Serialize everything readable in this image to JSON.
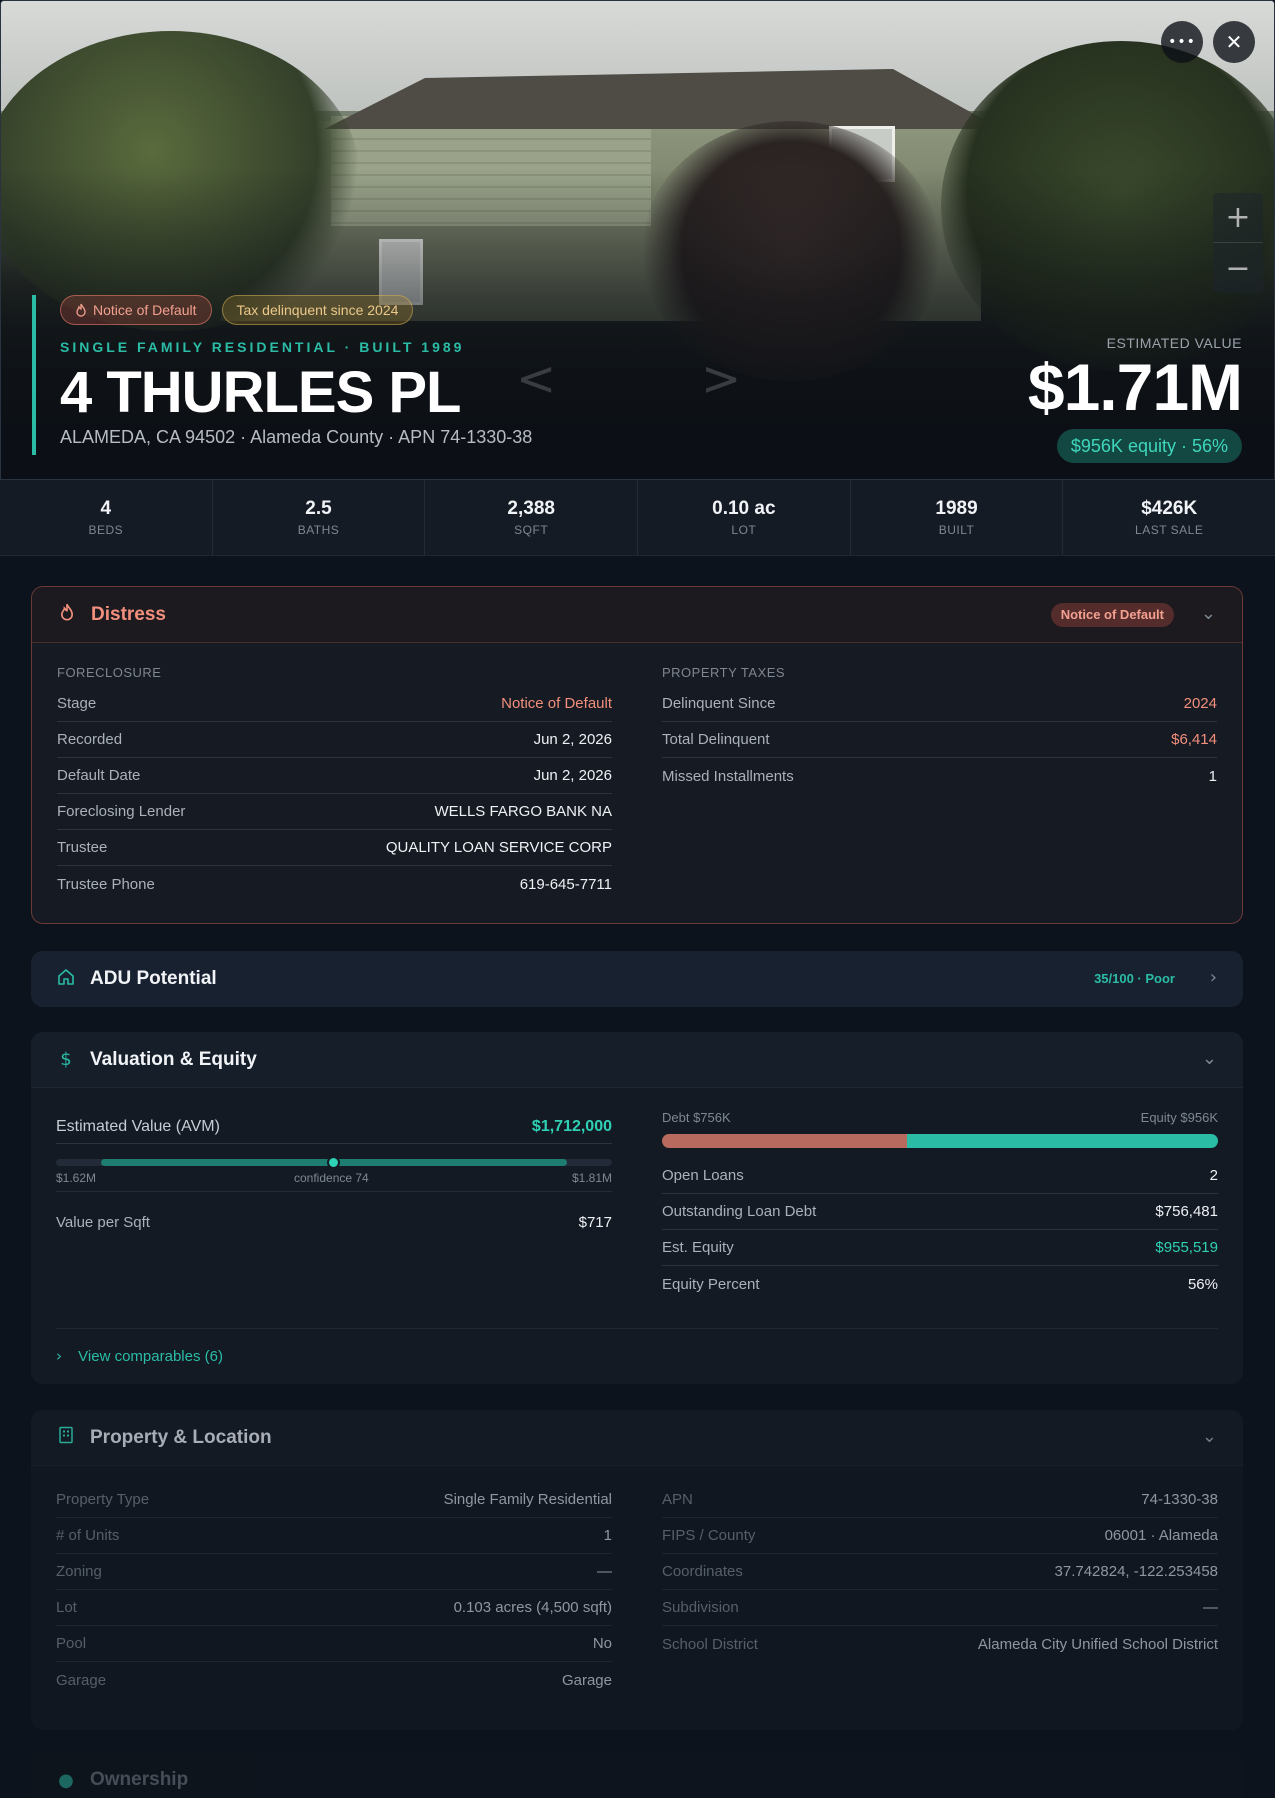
{
  "hero": {
    "badges": [
      "Notice of Default",
      "Tax delinquent since 2024"
    ],
    "subtitle": "SINGLE FAMILY RESIDENTIAL · BUILT 1989",
    "address": "4 THURLES PL",
    "location": "ALAMEDA, CA 94502 · Alameda County · APN 74-1330-38",
    "value_label": "ESTIMATED VALUE",
    "value": "$1.71M",
    "equity_pill": "$956K equity · 56%",
    "buttons": {
      "more": "•••",
      "close": "✕",
      "zoom_in": "+",
      "zoom_out": "−",
      "prev": "<",
      "next": ">"
    }
  },
  "stats": [
    {
      "value": "4",
      "label": "BEDS"
    },
    {
      "value": "2.5",
      "label": "BATHS"
    },
    {
      "value": "2,388",
      "label": "SQFT"
    },
    {
      "value": "0.10 ac",
      "label": "LOT"
    },
    {
      "value": "1989",
      "label": "BUILT"
    },
    {
      "value": "$426K",
      "label": "LAST SALE"
    }
  ],
  "distress": {
    "title": "Distress",
    "badge": "Notice of Default",
    "foreclosure": {
      "heading": "FORECLOSURE",
      "rows": [
        {
          "k": "Stage",
          "v": "Notice of Default"
        },
        {
          "k": "Recorded",
          "v": "Jun 2, 2026"
        },
        {
          "k": "Default Date",
          "v": "Jun 2, 2026"
        },
        {
          "k": "Foreclosing Lender",
          "v": "WELLS FARGO BANK NA"
        },
        {
          "k": "Trustee",
          "v": "QUALITY LOAN SERVICE CORP"
        },
        {
          "k": "Trustee Phone",
          "v": "619-645-7711"
        }
      ]
    },
    "taxes": {
      "heading": "PROPERTY TAXES",
      "rows": [
        {
          "k": "Delinquent Since",
          "v": "2024"
        },
        {
          "k": "Total Delinquent",
          "v": "$6,414"
        },
        {
          "k": "Missed Installments",
          "v": "1"
        }
      ]
    }
  },
  "adu": {
    "title": "ADU Potential",
    "score": "35/100 · Poor"
  },
  "valuation": {
    "title": "Valuation & Equity",
    "avm_label": "Estimated Value (AVM)",
    "avm_value": "$1,712,000",
    "range_low": "$1.62M",
    "range_high": "$1.81M",
    "confidence": "confidence 74",
    "value_per_sqft_label": "Value per Sqft",
    "value_per_sqft": "$717",
    "debt_label": "Debt $756K",
    "equity_label": "Equity $956K",
    "debt_fraction": 0.44,
    "rows": [
      {
        "k": "Open Loans",
        "v": "2"
      },
      {
        "k": "Outstanding Loan Debt",
        "v": "$756,481"
      },
      {
        "k": "Est. Equity",
        "v": "$955,519"
      },
      {
        "k": "Equity Percent",
        "v": "56%"
      }
    ],
    "comparables": "View comparables (6)"
  },
  "property": {
    "title": "Property & Location",
    "left": [
      {
        "k": "Property Type",
        "v": "Single Family Residential"
      },
      {
        "k": "# of Units",
        "v": "1"
      },
      {
        "k": "Zoning",
        "v": "—"
      },
      {
        "k": "Lot",
        "v": "0.103 acres (4,500 sqft)"
      },
      {
        "k": "Pool",
        "v": "No"
      },
      {
        "k": "Garage",
        "v": "Garage"
      }
    ],
    "right": [
      {
        "k": "APN",
        "v": "74-1330-38"
      },
      {
        "k": "FIPS / County",
        "v": "06001 · Alameda"
      },
      {
        "k": "Coordinates",
        "v": "37.742824, -122.253458"
      },
      {
        "k": "Subdivision",
        "v": "—"
      },
      {
        "k": "School District",
        "v": "Alameda City Unified School District"
      }
    ]
  },
  "ownership": {
    "title": "Ownership"
  },
  "colors": {
    "accent": "#2bbca6",
    "danger": "#f28f7d",
    "bg": "#0d131c"
  }
}
